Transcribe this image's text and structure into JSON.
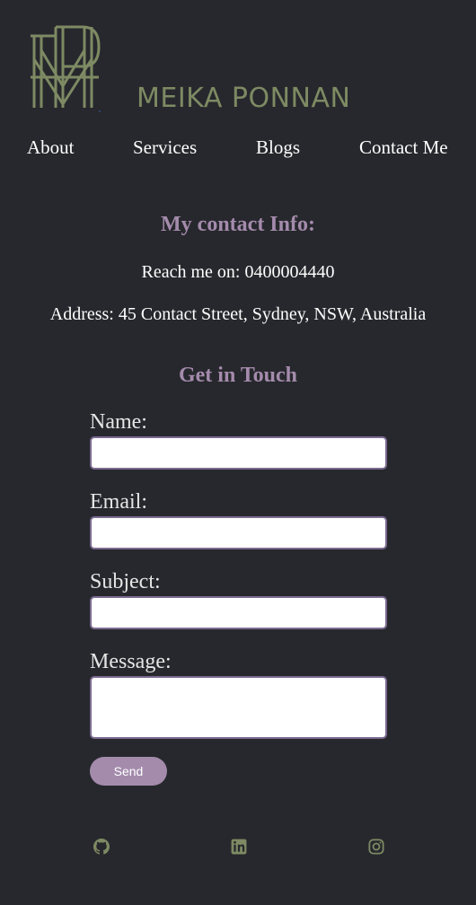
{
  "header": {
    "brand_name": "MEIKA PONNAN",
    "logo_icon": "mp-monogram-icon",
    "brand_color": "#7d8a63"
  },
  "nav": {
    "items": [
      {
        "label": "About"
      },
      {
        "label": "Services"
      },
      {
        "label": "Blogs"
      },
      {
        "label": "Contact Me"
      }
    ]
  },
  "contact_info": {
    "title": "My contact Info:",
    "phone_line": "Reach me on: 0400004440",
    "address_line": "Address: 45 Contact Street, Sydney, NSW, Australia"
  },
  "form": {
    "title": "Get in Touch",
    "name_label": "Name:",
    "name_value": "",
    "email_label": "Email:",
    "email_value": "",
    "subject_label": "Subject:",
    "subject_value": "",
    "message_label": "Message:",
    "message_value": "",
    "send_label": "Send"
  },
  "footer": {
    "social_icons": [
      "github-icon",
      "linkedin-icon",
      "instagram-icon"
    ]
  },
  "colors": {
    "background": "#27282d",
    "accent": "#a48bac",
    "logo": "#7d8a63"
  }
}
